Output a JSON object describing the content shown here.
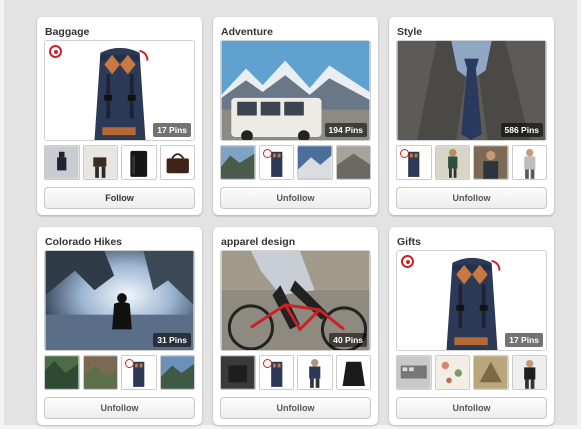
{
  "boards": [
    {
      "title": "Baggage",
      "pins": "17 Pins",
      "button": "Follow"
    },
    {
      "title": "Adventure",
      "pins": "194 Pins",
      "button": "Unfollow"
    },
    {
      "title": "Style",
      "pins": "586 Pins",
      "button": "Unfollow"
    },
    {
      "title": "Colorado Hikes",
      "pins": "31 Pins",
      "button": "Unfollow"
    },
    {
      "title": "apparel design",
      "pins": "40 Pins",
      "button": "Unfollow"
    },
    {
      "title": "Gifts",
      "pins": "17 Pins",
      "button": "Unfollow"
    }
  ],
  "colors": {
    "page_bg": "#e4e3e3",
    "card_bg": "#ffffff",
    "accent_red": "#cc2127",
    "backpack_navy": "#2c3a57",
    "strap_orange": "#c9783f"
  }
}
